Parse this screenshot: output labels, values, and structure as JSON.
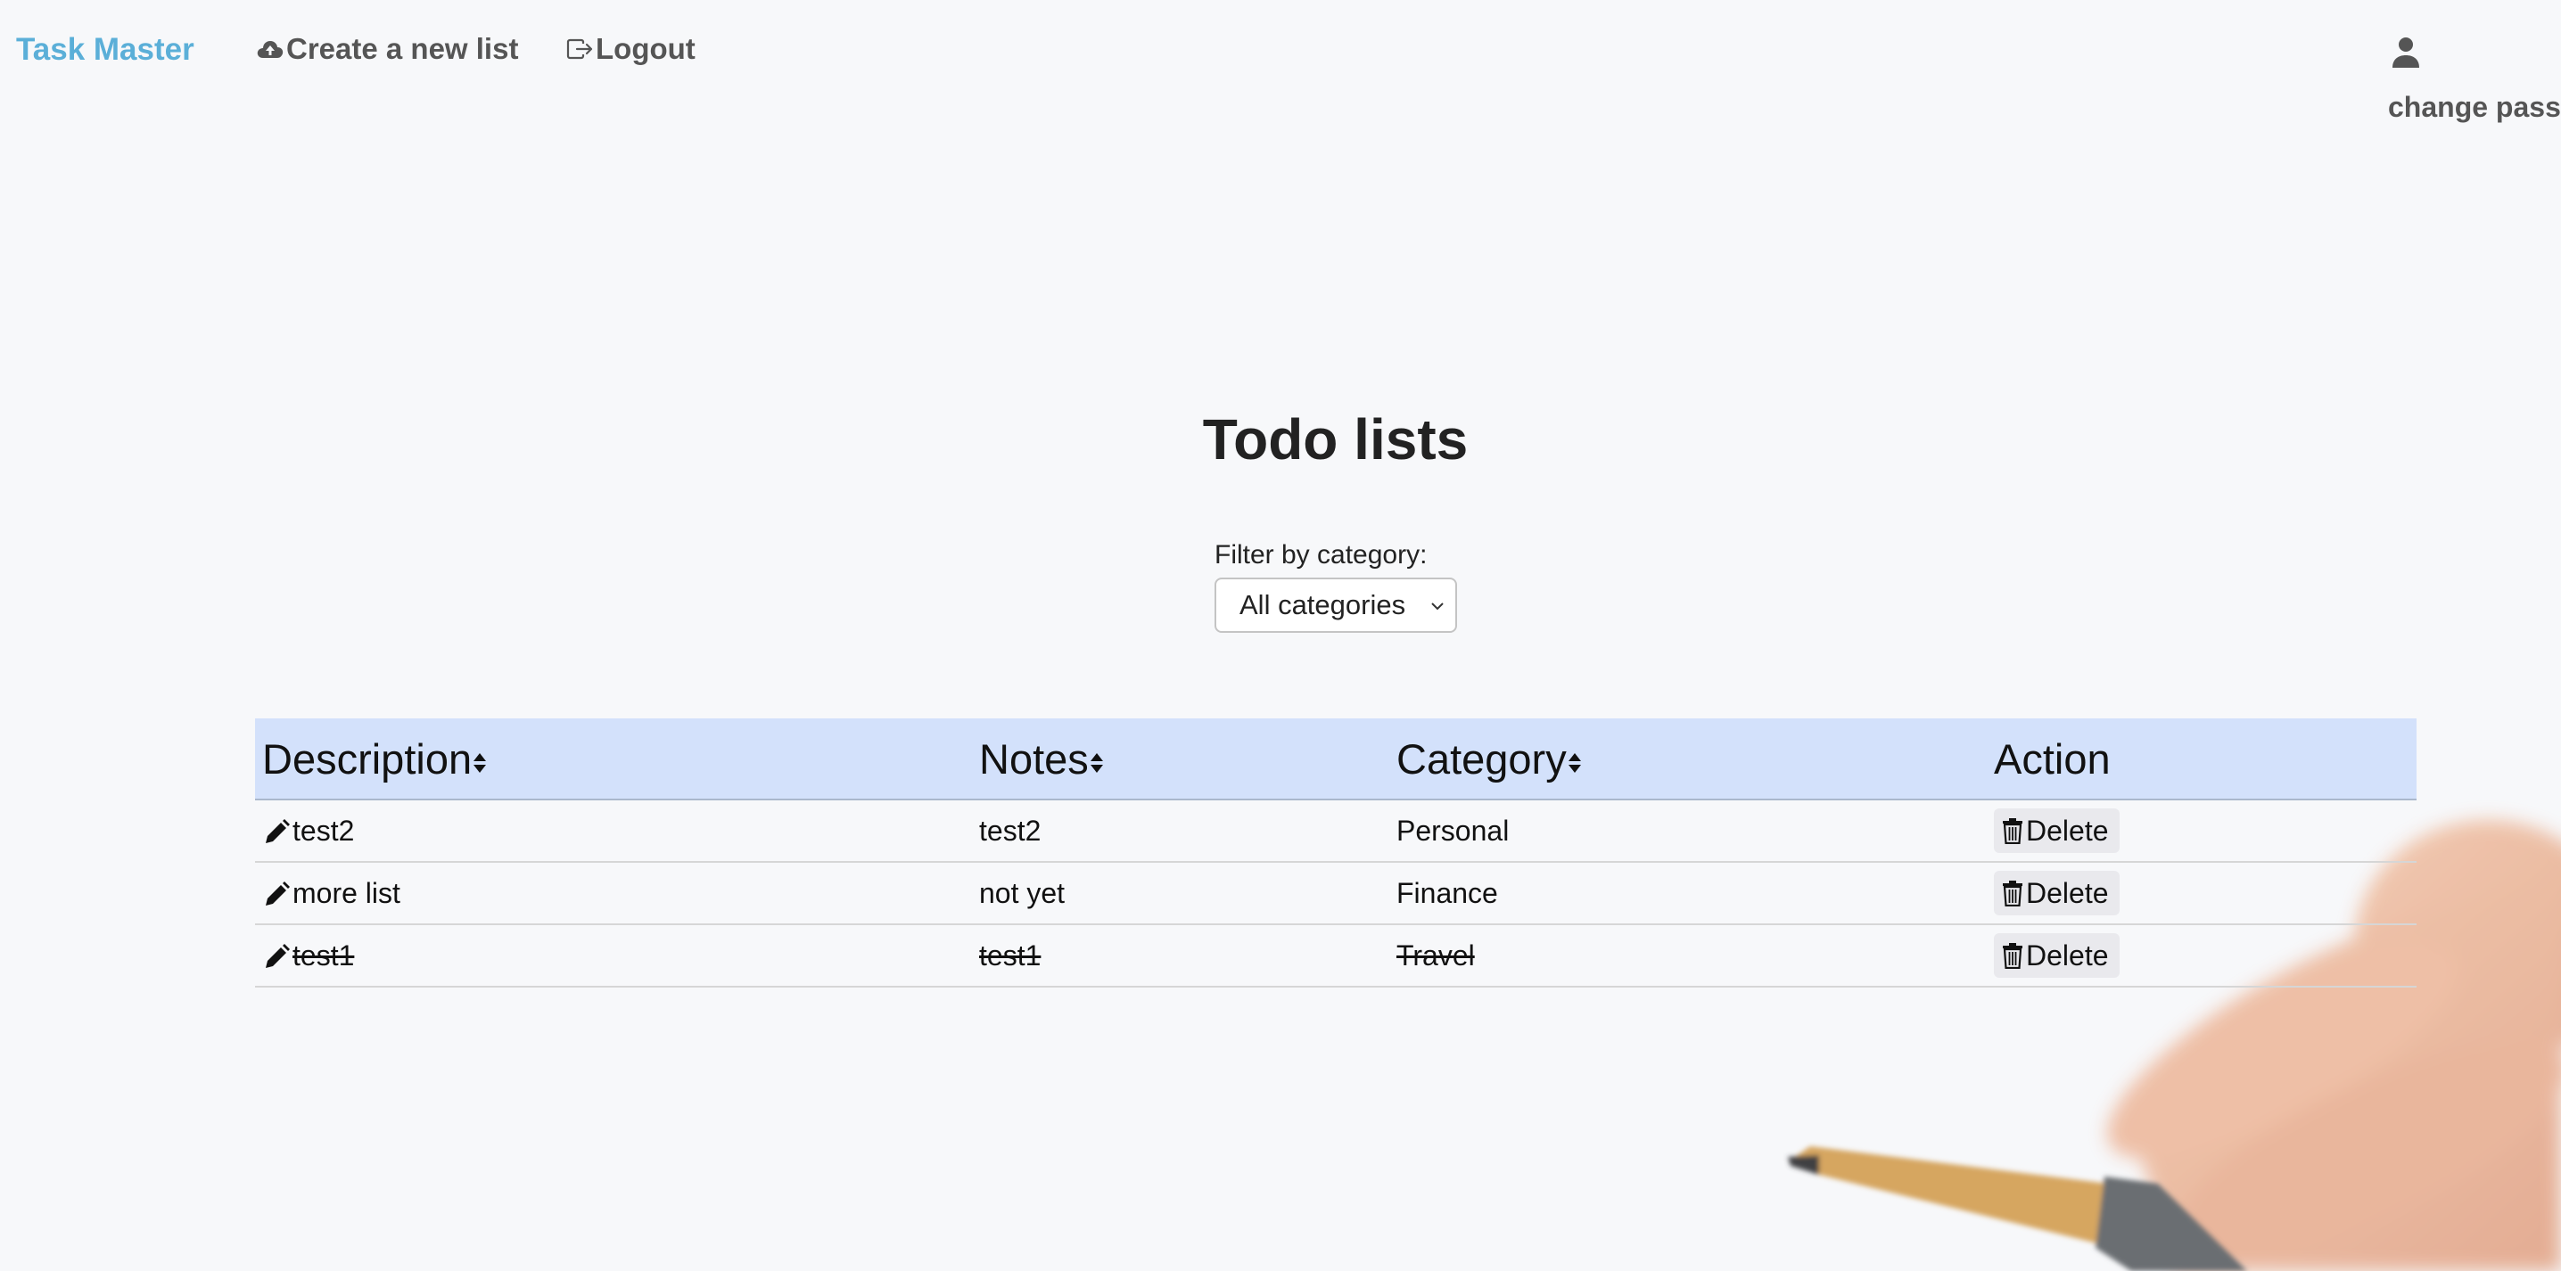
{
  "nav": {
    "brand": "Task Master",
    "create_label": "Create a new list",
    "logout_label": "Logout",
    "change_pass_label": "change pass"
  },
  "main": {
    "title": "Todo lists",
    "filter_label": "Filter by category:",
    "filter_selected": "All categories"
  },
  "table": {
    "headers": {
      "description": "Description",
      "notes": "Notes",
      "category": "Category",
      "action": "Action"
    },
    "delete_label": "Delete",
    "rows": [
      {
        "description": "test2",
        "notes": "test2",
        "category": "Personal",
        "done": false
      },
      {
        "description": "more list",
        "notes": "not yet",
        "category": "Finance",
        "done": false
      },
      {
        "description": "test1",
        "notes": "test1",
        "category": "Travel",
        "done": true
      }
    ]
  },
  "colors": {
    "brand": "#5bafd8",
    "header_bg": "#d3e1fb",
    "page_bg": "#f7f8fa"
  }
}
